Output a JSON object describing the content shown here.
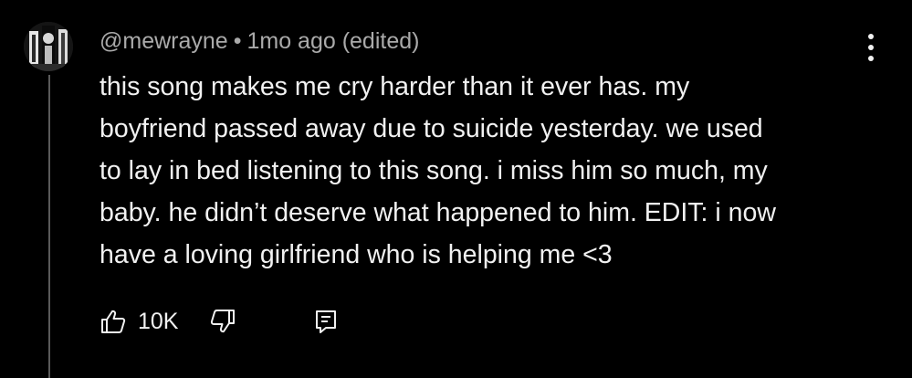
{
  "comment": {
    "author": "@mewrayne",
    "separator": "•",
    "timestamp": "1mo ago (edited)",
    "text": "this song makes me cry harder than it ever has. my\nboyfriend passed away due to suicide yesterday. we used\nto lay in bed listening to this song. i miss him so much, my\nbaby. he didn’t deserve what happened to him. EDIT: i now\nhave a loving girlfriend who is helping me <3"
  },
  "actions": {
    "like_icon": "thumbs-up-icon",
    "like_count": "10K",
    "dislike_icon": "thumbs-down-icon",
    "reply_icon": "reply-icon"
  },
  "menu": {
    "icon": "more-vertical-icon"
  },
  "colors": {
    "background": "#000000",
    "text_primary": "#f1f1f1",
    "text_secondary": "#aaaaaa",
    "thread_line": "#5a5a5a"
  }
}
